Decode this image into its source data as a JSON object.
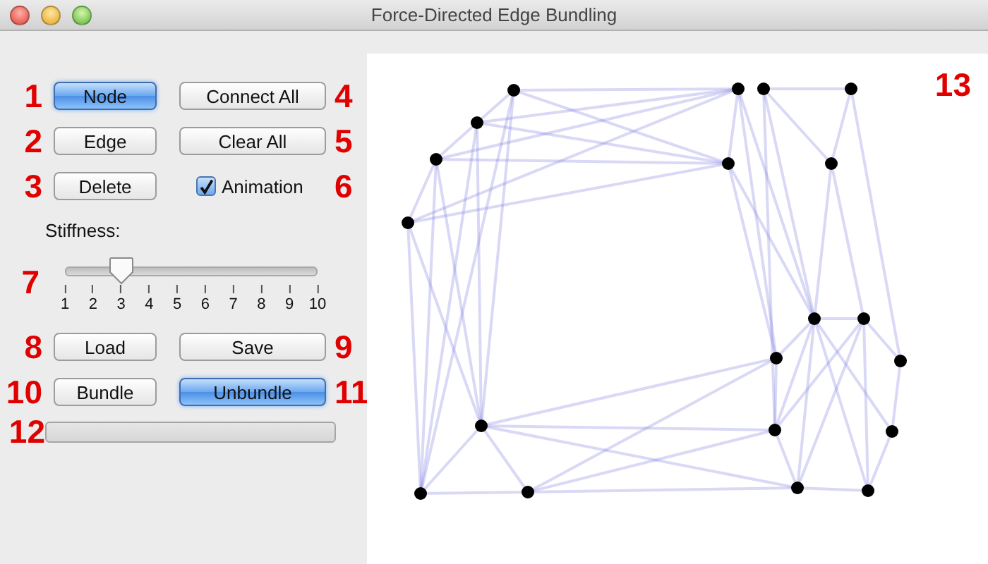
{
  "window": {
    "title": "Force-Directed Edge Bundling"
  },
  "panel": [
    {
      "kind": "row",
      "items": [
        {
          "kind": "marker",
          "text": "1"
        },
        {
          "kind": "button",
          "label": "Node",
          "highlighted": true
        },
        {
          "kind": "button",
          "label": "Connect All",
          "highlighted": false
        },
        {
          "kind": "marker",
          "text": "4"
        }
      ]
    },
    {
      "kind": "row",
      "items": [
        {
          "kind": "marker",
          "text": "2"
        },
        {
          "kind": "button",
          "label": "Edge",
          "highlighted": false
        },
        {
          "kind": "button",
          "label": "Clear All",
          "highlighted": false
        },
        {
          "kind": "marker",
          "text": "5"
        }
      ]
    },
    {
      "kind": "row",
      "items": [
        {
          "kind": "marker",
          "text": "3"
        },
        {
          "kind": "button",
          "label": "Delete",
          "highlighted": false
        },
        {
          "kind": "checkbox",
          "label": "Animation",
          "checked": true
        },
        {
          "kind": "marker",
          "text": "6"
        }
      ]
    },
    {
      "kind": "label",
      "text": "Stiffness:"
    },
    {
      "kind": "slider",
      "marker": "7",
      "level": 0.222,
      "ticks": [
        "1",
        "2",
        "3",
        "4",
        "5",
        "6",
        "7",
        "8",
        "9",
        "10"
      ]
    },
    {
      "kind": "row",
      "items": [
        {
          "kind": "marker",
          "text": "8"
        },
        {
          "kind": "button",
          "label": "Load",
          "highlighted": false
        },
        {
          "kind": "button",
          "label": "Save",
          "highlighted": false
        },
        {
          "kind": "marker",
          "text": "9"
        }
      ]
    },
    {
      "kind": "row",
      "items": [
        {
          "kind": "marker",
          "text": "10"
        },
        {
          "kind": "button",
          "label": "Bundle",
          "highlighted": false
        },
        {
          "kind": "button",
          "label": "Unbundle",
          "highlighted": true
        },
        {
          "kind": "marker",
          "text": "11"
        }
      ]
    },
    {
      "kind": "progress",
      "marker": "12",
      "level": 0
    }
  ],
  "canvas": {
    "marker": "13"
  }
}
